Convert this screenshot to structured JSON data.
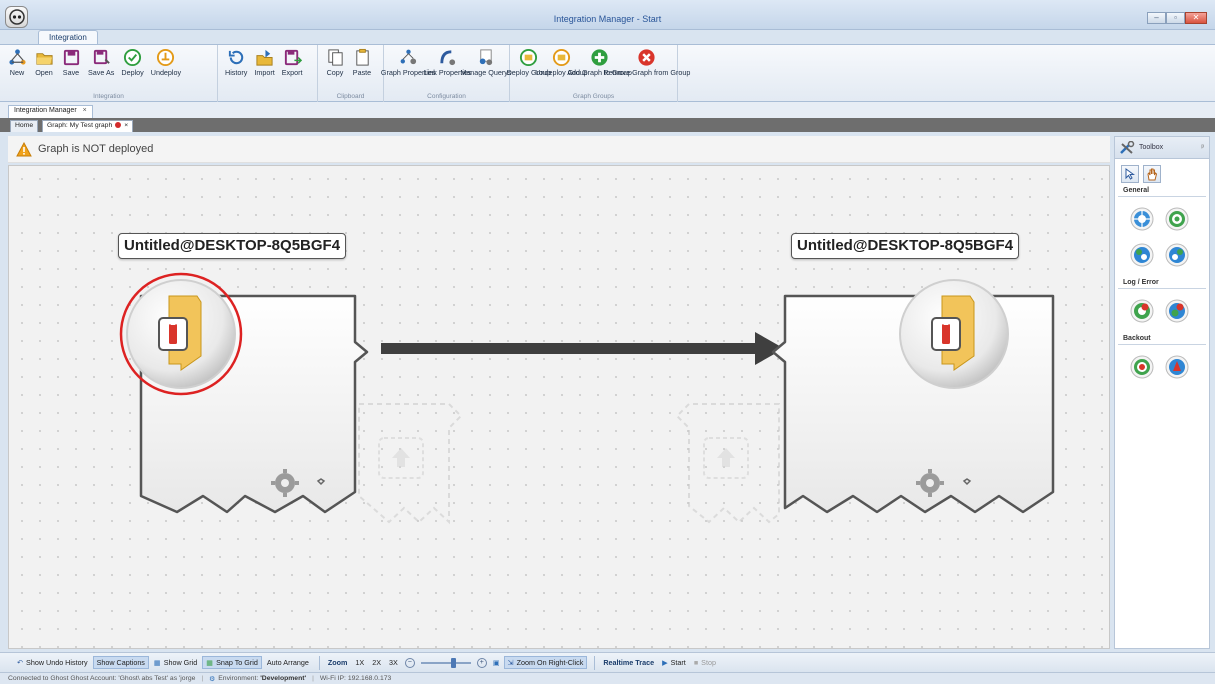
{
  "window": {
    "title": "Integration Manager - Start"
  },
  "ribbon": {
    "tab": "Integration",
    "groups": [
      {
        "name": "integration",
        "label": "Integration",
        "buttons": [
          {
            "label": "New",
            "icon": "new-graph-icon"
          },
          {
            "label": "Open",
            "icon": "open-folder-icon"
          },
          {
            "label": "Save",
            "icon": "save-icon"
          },
          {
            "label": "Save As",
            "icon": "save-as-icon"
          },
          {
            "label": "Deploy",
            "icon": "deploy-icon"
          },
          {
            "label": "Undeploy",
            "icon": "undeploy-icon"
          }
        ]
      },
      {
        "name": "history",
        "label": "",
        "buttons": [
          {
            "label": "History",
            "icon": "history-icon"
          },
          {
            "label": "Import",
            "icon": "import-icon"
          },
          {
            "label": "Export",
            "icon": "export-icon"
          }
        ]
      },
      {
        "name": "clipboard",
        "label": "Clipboard",
        "buttons": [
          {
            "label": "Copy",
            "icon": "copy-icon"
          },
          {
            "label": "Paste",
            "icon": "paste-icon"
          }
        ]
      },
      {
        "name": "configuration",
        "label": "Configuration",
        "buttons": [
          {
            "label": "Graph Properties",
            "icon": "graph-properties-icon"
          },
          {
            "label": "Link Properties",
            "icon": "link-properties-icon"
          },
          {
            "label": "Manage Querys",
            "icon": "manage-querys-icon"
          }
        ]
      },
      {
        "name": "graph-groups",
        "label": "Graph Groups",
        "buttons": [
          {
            "label": "Deploy Group",
            "icon": "deploy-group-icon"
          },
          {
            "label": "Undeploy Group",
            "icon": "undeploy-group-icon"
          },
          {
            "label": "Add Graph to Group",
            "icon": "add-graph-icon"
          },
          {
            "label": "Remove Graph from Group",
            "icon": "remove-graph-icon"
          }
        ]
      }
    ]
  },
  "doc_tab": {
    "label": "Integration Manager",
    "close": "×"
  },
  "graph_tabs": {
    "home": "Home",
    "active": "Graph: My Test graph",
    "close": "×"
  },
  "warning": {
    "text": "Graph is NOT deployed"
  },
  "nodes": [
    {
      "caption": "Untitled@DESKTOP-8Q5BGF4"
    },
    {
      "caption": "Untitled@DESKTOP-8Q5BGF4"
    }
  ],
  "toolbox": {
    "title": "Toolbox",
    "pin": "ᵖ",
    "sections": [
      {
        "label": "General",
        "items": [
          "general-tool-1-icon",
          "general-tool-2-icon",
          "general-tool-3-icon",
          "general-tool-4-icon"
        ]
      },
      {
        "label": "Log / Error",
        "items": [
          "log-error-tool-1-icon",
          "log-error-tool-2-icon"
        ]
      },
      {
        "label": "Backout",
        "items": [
          "backout-tool-1-icon",
          "backout-tool-2-icon"
        ]
      }
    ]
  },
  "bottom_toolbar": {
    "undo_history": "Show Undo History",
    "show_captions": "Show Captions",
    "show_grid": "Show Grid",
    "snap_to_grid": "Snap To Grid",
    "auto_arrange": "Auto Arrange",
    "zoom_label": "Zoom",
    "zoom_1x": "1X",
    "zoom_2x": "2X",
    "zoom_3x": "3X",
    "zoom_minus": "−",
    "zoom_plus": "+",
    "zoom_right_click": "Zoom On Right-Click",
    "realtime_trace": "Realtime Trace",
    "start": "Start",
    "stop": "Stop"
  },
  "status_bar": {
    "connection": "Connected to Ghost Ghost Account: 'Ghost\\ abs Test' as 'jorge",
    "environment_label": "Environment:",
    "environment_value": "'Development'",
    "wifi": "Wi-Fi IP: 192.168.0.173"
  }
}
